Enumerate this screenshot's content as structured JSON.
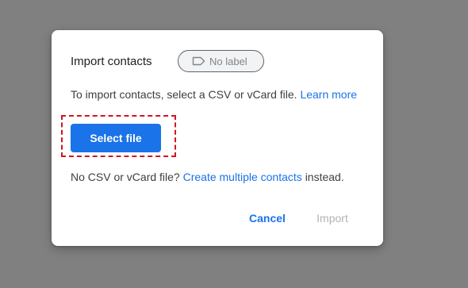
{
  "dialog": {
    "title": "Import contacts",
    "label_chip": {
      "icon": "label-icon",
      "text": "No label"
    },
    "intro": {
      "text": "To import contacts, select a CSV or vCard file.",
      "learn_more": "Learn more"
    },
    "select_file_label": "Select file",
    "alternative": {
      "prefix": "No CSV or vCard file?",
      "link": "Create multiple contacts",
      "suffix": "instead."
    },
    "actions": {
      "cancel": "Cancel",
      "import": "Import"
    }
  },
  "colors": {
    "backdrop": "#808080",
    "accent": "#1a73e8",
    "highlight": "#d3141f",
    "disabled": "#b0b3b8"
  }
}
